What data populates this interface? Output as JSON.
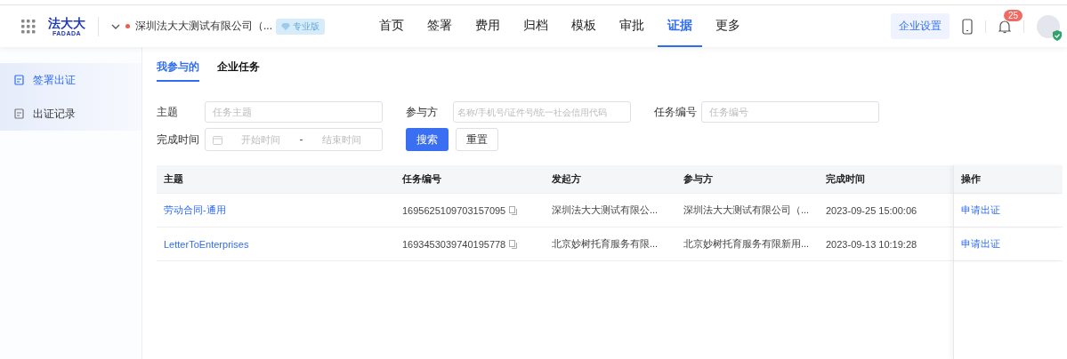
{
  "header": {
    "logo": {
      "top": "法大大",
      "bottom": "FADADA"
    },
    "company": "深圳法大大测试有限公司（...",
    "edition": "专业版",
    "nav": [
      {
        "label": "首页",
        "selected": false
      },
      {
        "label": "签署",
        "selected": false
      },
      {
        "label": "费用",
        "selected": false
      },
      {
        "label": "归档",
        "selected": false
      },
      {
        "label": "模板",
        "selected": false
      },
      {
        "label": "审批",
        "selected": false
      },
      {
        "label": "证据",
        "selected": true
      },
      {
        "label": "更多",
        "selected": false
      }
    ],
    "settings_button": "企业设置",
    "notification_count": "25"
  },
  "sidebar": {
    "items": [
      {
        "label": "签署出证",
        "selected": true
      },
      {
        "label": "出证记录",
        "selected": false
      }
    ]
  },
  "tabs": [
    {
      "label": "我参与的",
      "selected": true
    },
    {
      "label": "企业任务",
      "selected": false
    }
  ],
  "filters": {
    "subject": {
      "label": "主题",
      "placeholder": "任务主题"
    },
    "participant": {
      "label": "参与方",
      "placeholder": "名称/手机号/证件号/统一社会信用代码"
    },
    "task_no": {
      "label": "任务编号",
      "placeholder": "任务编号"
    },
    "finish_time": {
      "label": "完成时间",
      "start_placeholder": "开始时间",
      "separator": "-",
      "end_placeholder": "结束时间"
    },
    "search_button": "搜索",
    "reset_button": "重置"
  },
  "table": {
    "columns": [
      "主题",
      "任务编号",
      "发起方",
      "参与方",
      "完成时间",
      "操作"
    ],
    "rows": [
      {
        "subject": "劳动合同-通用",
        "task_no": "1695625109703157095",
        "initiator": "深圳法大大测试有限公...",
        "participant": "深圳法大大测试有限公司（...",
        "finished": "2023-09-25 15:00:06",
        "action": "申请出证"
      },
      {
        "subject": "LetterToEnterprises",
        "task_no": "1693453039740195778",
        "initiator": "北京妙树托育服务有限...",
        "participant": "北京妙树托育服务有限新用...",
        "finished": "2023-09-13 10:19:28",
        "action": "申请出证"
      }
    ]
  }
}
